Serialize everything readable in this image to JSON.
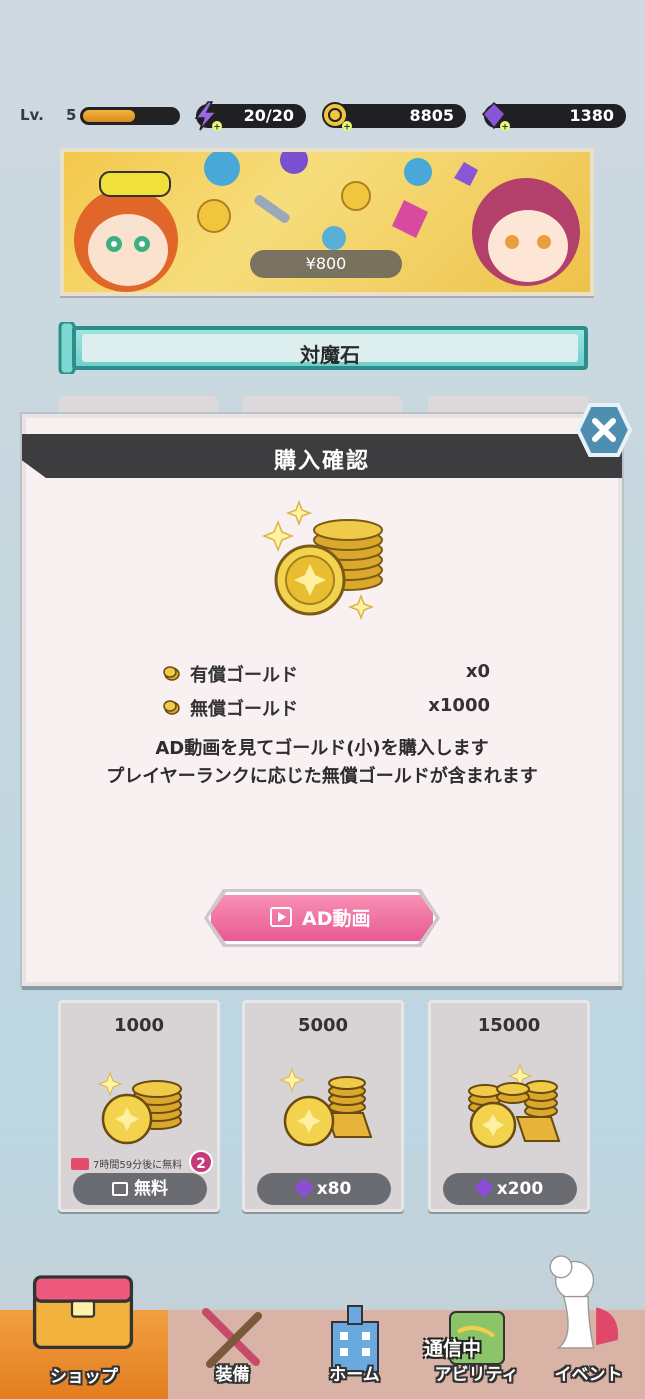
{
  "status_bar": {
    "level_label": "Lv.",
    "level": "5",
    "level_progress": 0.55,
    "energy": "20/20",
    "coins": "8805",
    "gems": "1380"
  },
  "banner": {
    "price": "¥800"
  },
  "section": {
    "title": "対魔石"
  },
  "modal": {
    "title": "購入確認",
    "rows": [
      {
        "label": "有償ゴールド",
        "qty": "x0"
      },
      {
        "label": "無償ゴールド",
        "qty": "x1000"
      }
    ],
    "desc_line1": "AD動画を見てゴールド(小)を購入します",
    "desc_line2": "プレイヤーランクに応じた無償ゴールドが含まれます",
    "ad_button": "AD動画"
  },
  "products": [
    {
      "amount": "1000",
      "timer": "7時間59分後に無料",
      "price": "無料",
      "badge": "2"
    },
    {
      "amount": "5000",
      "price": "x80"
    },
    {
      "amount": "15000",
      "price": "x200"
    }
  ],
  "nav": {
    "shop": "ショップ",
    "equip": "装備",
    "home": "ホーム",
    "activity": "アビリティ",
    "comm": "通信中",
    "event": "イベント"
  },
  "colors": {
    "accent_teal": "#2c8e8a",
    "pink_button": "#e75a92",
    "nav_active": "#e27d20"
  }
}
